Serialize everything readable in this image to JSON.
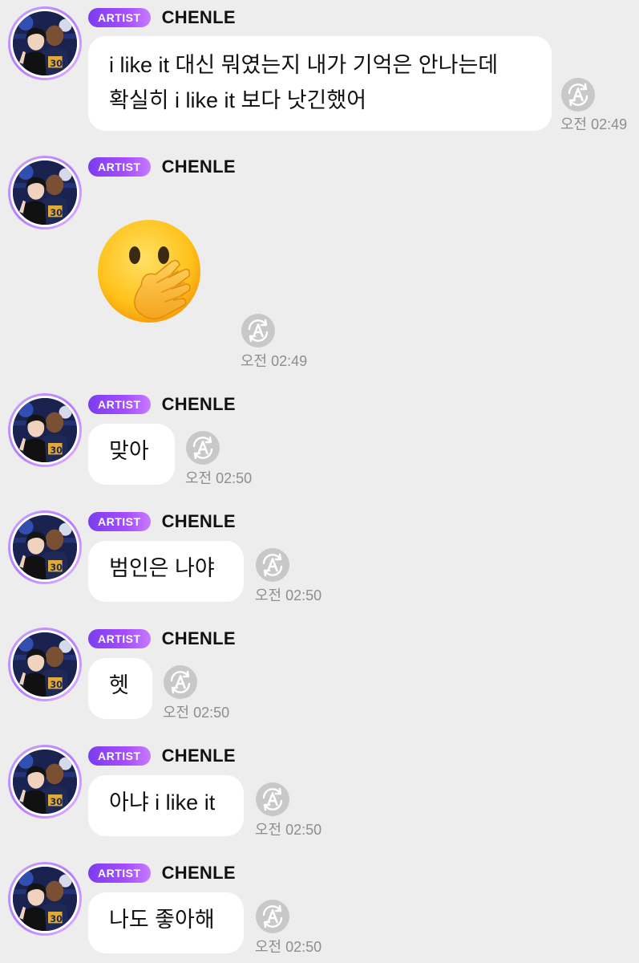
{
  "messages": [
    {
      "badge": "ARTIST",
      "author": "CHENLE",
      "lines": [
        "i like it 대신 뭐였는지 내가 기억은 안나는데",
        "확실히 i like it 보다 낫긴했어"
      ],
      "time": "오전 02:49"
    },
    {
      "badge": "ARTIST",
      "author": "CHENLE",
      "emoji": "face-with-hand-over-mouth",
      "time": "오전 02:49"
    },
    {
      "badge": "ARTIST",
      "author": "CHENLE",
      "text": "맞아",
      "time": "오전 02:50"
    },
    {
      "badge": "ARTIST",
      "author": "CHENLE",
      "text": "범인은 나야",
      "time": "오전 02:50"
    },
    {
      "badge": "ARTIST",
      "author": "CHENLE",
      "text": "헷",
      "time": "오전 02:50"
    },
    {
      "badge": "ARTIST",
      "author": "CHENLE",
      "text": "아냐 i like it",
      "time": "오전 02:50"
    },
    {
      "badge": "ARTIST",
      "author": "CHENLE",
      "text": "나도 좋아해",
      "time": "오전 02:50"
    }
  ],
  "colors": {
    "background": "#ededed",
    "bubble": "#ffffff",
    "badge_start": "#7b3df0",
    "badge_end": "#c77bff",
    "time": "#8e8e8e",
    "translate_icon": "#c8c8c8"
  },
  "icons": {
    "translate": "translate-icon",
    "avatar": "avatar-photo"
  }
}
